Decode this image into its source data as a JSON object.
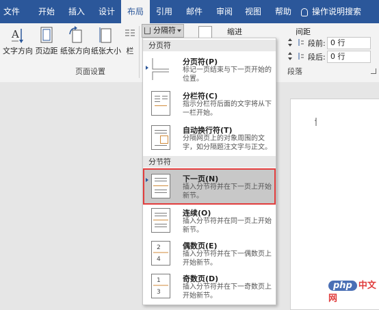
{
  "tabs": [
    "文件",
    "开始",
    "插入",
    "设计",
    "布局",
    "引用",
    "邮件",
    "审阅",
    "视图",
    "帮助"
  ],
  "active_tab": "布局",
  "search": {
    "label": "操作说明搜索"
  },
  "ribbon": {
    "buttons": [
      "文字方向",
      "页边距",
      "纸张方向",
      "纸张大小",
      "栏"
    ],
    "group_page_setup": "页面设置",
    "breaks_label": "分隔符",
    "indent_label": "缩进",
    "spacing_label": "间距",
    "before_label": "段前:",
    "after_label": "段后:",
    "before_value": "0 行",
    "after_value": "0 行",
    "group_paragraph": "段落"
  },
  "menu": {
    "section_page": "分页符",
    "section_section": "分节符",
    "items": [
      {
        "title": "分页符(P)",
        "desc": "标记一页结束与下一页开始的位置。",
        "icon": "page-break-icon"
      },
      {
        "title": "分栏符(C)",
        "desc": "指示分栏符后面的文字将从下一栏开始。",
        "icon": "column-break-icon"
      },
      {
        "title": "自动换行符(T)",
        "desc": "分隔网页上的对象周围的文字，如分隔题注文字与正文。",
        "icon": "text-wrapping-icon"
      },
      {
        "title": "下一页(N)",
        "desc": "插入分节符并在下一页上开始新节。",
        "icon": "next-page-icon"
      },
      {
        "title": "连续(O)",
        "desc": "插入分节符并在同一页上开始新节。",
        "icon": "continuous-icon"
      },
      {
        "title": "偶数页(E)",
        "desc": "插入分节符并在下一偶数页上开始新节。",
        "icon": "even-page-icon"
      },
      {
        "title": "奇数页(D)",
        "desc": "插入分节符并在下一奇数页上开始新节。",
        "icon": "odd-page-icon"
      }
    ]
  },
  "watermark": {
    "badge": "php",
    "text": "中文网"
  },
  "colors": {
    "accent": "#2b579a",
    "highlight_border": "#e23c3c"
  }
}
